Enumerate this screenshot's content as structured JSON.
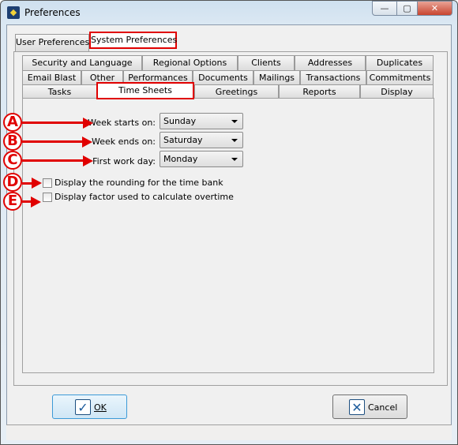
{
  "window": {
    "title": "Preferences",
    "minimize": "—",
    "maximize": "▢",
    "close": "✕"
  },
  "top_tabs": [
    {
      "label": "User Preferences",
      "selected": false
    },
    {
      "label": "System Preferences",
      "selected": true
    }
  ],
  "sub_tabs": {
    "row1": [
      "Security and Language",
      "Regional Options",
      "Clients",
      "Addresses",
      "Duplicates"
    ],
    "row2": [
      "Email Blast",
      "Other",
      "Performances",
      "Documents",
      "Mailings",
      "Transactions",
      "Commitments"
    ],
    "row3": [
      "Tasks",
      "Time Sheets",
      "Greetings",
      "Reports",
      "Display"
    ],
    "selected": "Time Sheets"
  },
  "form": {
    "week_starts": {
      "label": "Week starts on:",
      "value": "Sunday"
    },
    "week_ends": {
      "label": "Week ends on:",
      "value": "Saturday"
    },
    "first_work_day": {
      "label": "First work day:",
      "value": "Monday"
    },
    "rounding": {
      "label": "Display the rounding for the time bank",
      "checked": false
    },
    "overtime_factor": {
      "label": "Display factor used to calculate overtime",
      "checked": false
    }
  },
  "annotations": [
    "A",
    "B",
    "C",
    "D",
    "E"
  ],
  "buttons": {
    "ok": "OK",
    "cancel": "Cancel"
  },
  "colors": {
    "annotation": "#e00000",
    "accent": "#3c9ad7"
  }
}
